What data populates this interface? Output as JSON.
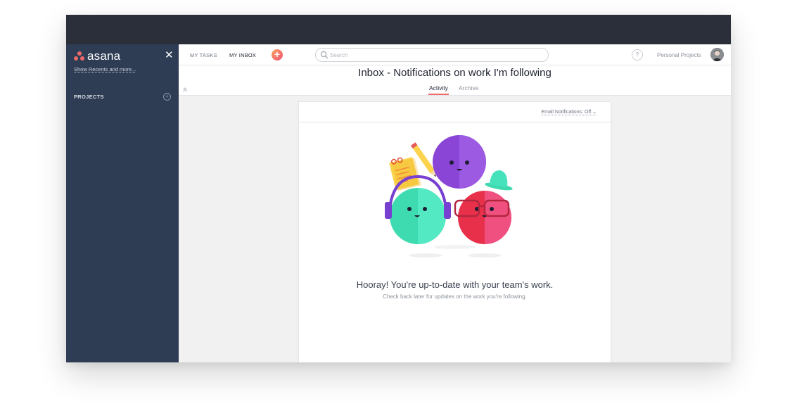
{
  "sidebar": {
    "brand": "asana",
    "recents_link": "Show Recents and more...",
    "projects_label": "PROJECTS"
  },
  "topbar": {
    "tabs": [
      {
        "label": "MY TASKS",
        "active": false
      },
      {
        "label": "MY INBOX",
        "active": true
      }
    ],
    "search_placeholder": "Search",
    "help_label": "?",
    "workspace": "Personal Projects"
  },
  "header": {
    "title": "Inbox - Notifications on work I'm following",
    "tabs": [
      {
        "label": "Activity",
        "active": true
      },
      {
        "label": "Archive",
        "active": false
      }
    ]
  },
  "card": {
    "email_notifications": "Email Notifications: Off",
    "empty_title": "Hooray! You're up-to-date with your team's work.",
    "empty_subtitle": "Check back later for updates on the work you're following."
  },
  "colors": {
    "sidebar_bg": "#2e3c54",
    "titlebar_bg": "#2b2f3a",
    "accent": "#f06a6a",
    "canvas_bg": "#f1f1f2"
  },
  "icons": [
    "asana-logo-icon",
    "close-icon",
    "add-project-icon",
    "add-task-icon",
    "search-icon",
    "help-icon",
    "chevron-down-icon",
    "collapse-icon"
  ]
}
